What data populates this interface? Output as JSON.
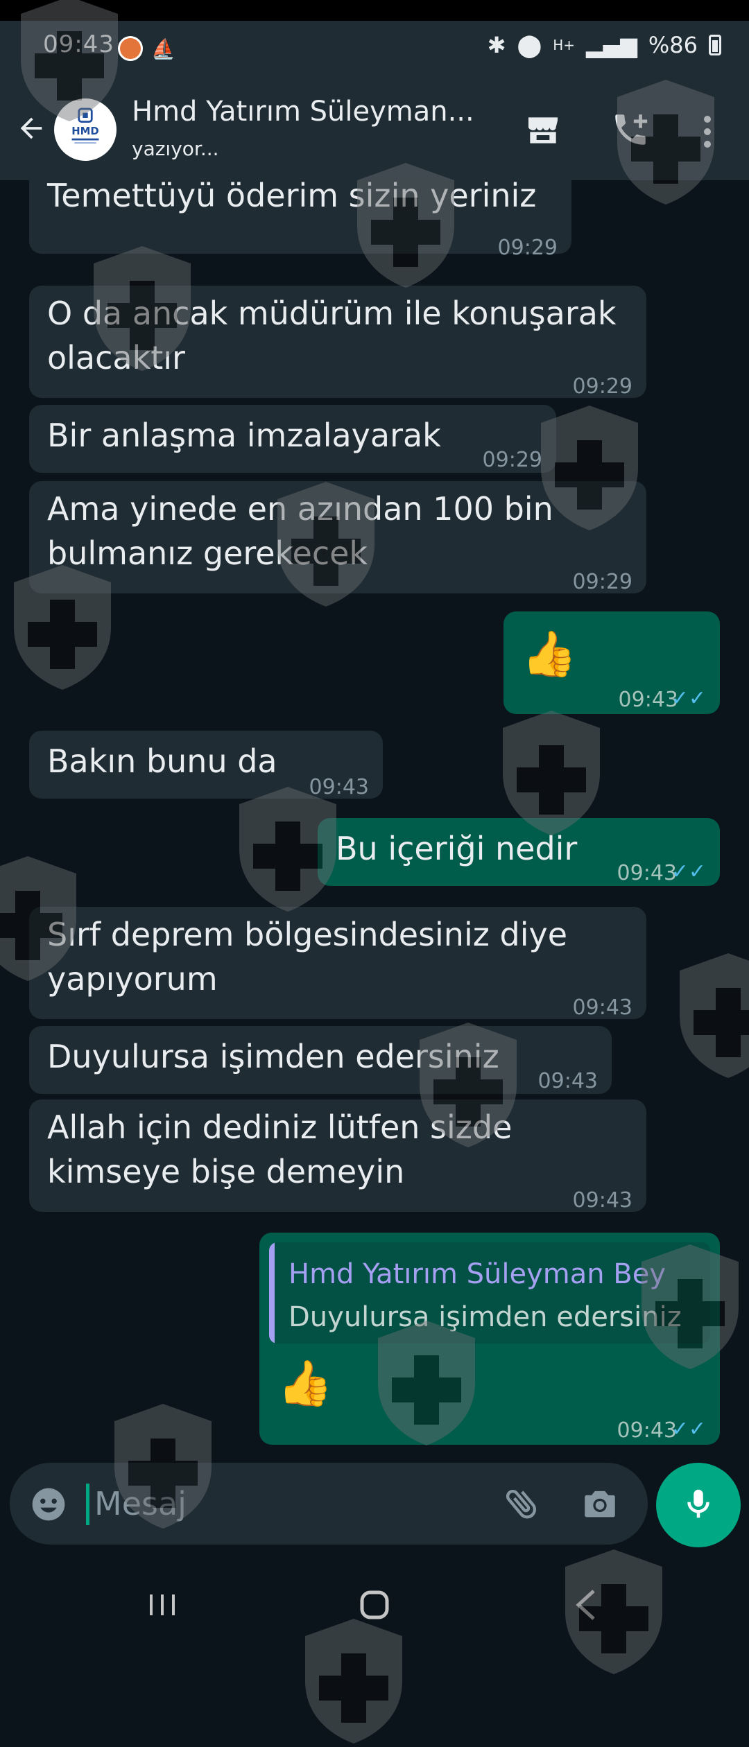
{
  "status_bar": {
    "time": "09:43",
    "network": "H+",
    "battery": "%86"
  },
  "header": {
    "contact_name": "Hmd Yatırım Süleyman...",
    "contact_status": "yazıyor...",
    "avatar_text": "HMD"
  },
  "messages": [
    {
      "dir": "in",
      "text": "Temettüyü öderim sizin yeriniz",
      "time": "09:29"
    },
    {
      "dir": "in",
      "text": "O da ancak müdürüm ile konuşarak\nolacaktır",
      "time": "09:29"
    },
    {
      "dir": "in",
      "text": "Bir anlaşma imzalayarak",
      "time": "09:29"
    },
    {
      "dir": "in",
      "text": "Ama yinede en azından 100 bin\nbulmanız gerekecek",
      "time": "09:29"
    },
    {
      "dir": "out",
      "text": "👍",
      "time": "09:43"
    },
    {
      "dir": "in",
      "text": "Bakın bunu da",
      "time": "09:43"
    },
    {
      "dir": "out",
      "text": "Bu içeriği nedir",
      "time": "09:43"
    },
    {
      "dir": "in",
      "text": "Sırf deprem bölgesindesiniz diye\nyapıyorum",
      "time": "09:43"
    },
    {
      "dir": "in",
      "text": "Duyulursa işimden edersiniz",
      "time": "09:43"
    },
    {
      "dir": "in",
      "text": "Allah için dediniz lütfen sizde\nkimseye bişe demeyin",
      "time": "09:43"
    },
    {
      "dir": "out",
      "text": "👍",
      "time": "09:43",
      "quote_author": "Hmd Yatırım Süleyman Bey",
      "quote_text": "Duyulursa işimden edersiniz"
    }
  ],
  "composer": {
    "placeholder": "Mesaj"
  },
  "icons": {
    "back": "arrow-left-icon",
    "store": "store-icon",
    "call": "add-call-icon",
    "menu": "more-vert-icon",
    "emoji": "emoji-icon",
    "attach": "paperclip-icon",
    "camera": "camera-icon",
    "mic": "mic-icon",
    "read": "double-check-icon",
    "watermark": "shield-cross-icon"
  },
  "colors": {
    "incoming": "#202c33",
    "outgoing": "#005c4b",
    "accent": "#00a884",
    "read_ticks": "#53bdeb",
    "quote_author": "#a5a0f1"
  }
}
